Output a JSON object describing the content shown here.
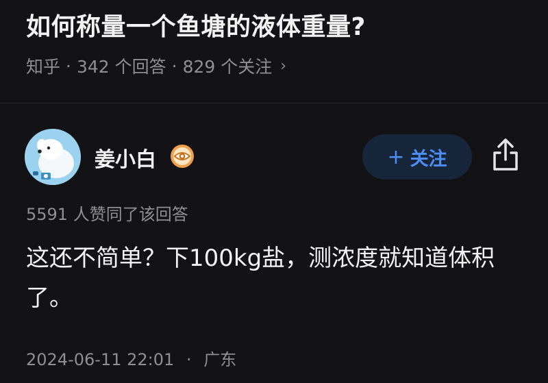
{
  "question": {
    "title": "如何称量一个鱼塘的液体重量?",
    "source": "知乎",
    "answers_count": "342 个回答",
    "followers_count": "829 个关注"
  },
  "answer": {
    "author_name": "姜小白",
    "follow_label": "关注",
    "upvote_text": "5591 人赞同了该回答",
    "body": "这还不简单？下100kg盐，测浓度就知道体积了。",
    "date": "2024-06-11 22:01",
    "location": "广东"
  },
  "icons": {
    "chevron": "chevron-right-icon",
    "badge": "eye-badge-icon",
    "share": "share-icon",
    "plus": "plus-icon"
  },
  "colors": {
    "background": "#121214",
    "accent": "#4d8ef5",
    "follow_bg": "#16253a",
    "muted": "#8e8e93",
    "badge": "#f0a04b"
  }
}
